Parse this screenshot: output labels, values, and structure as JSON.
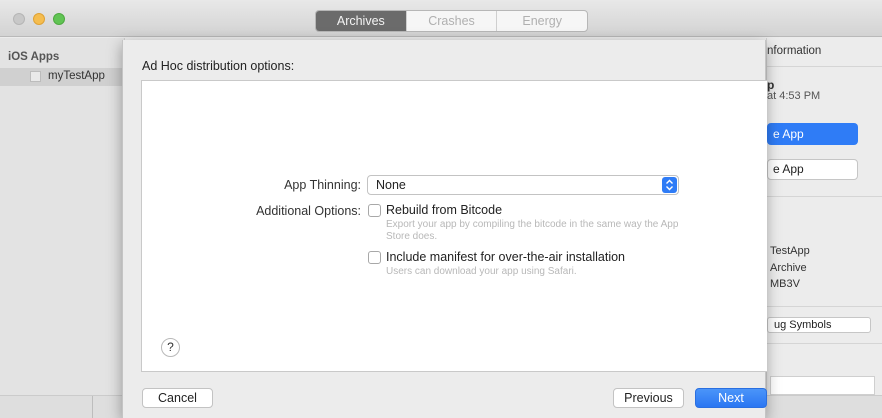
{
  "toolbar": {
    "tabs": [
      {
        "label": "Archives",
        "active": true
      },
      {
        "label": "Crashes",
        "active": false
      },
      {
        "label": "Energy",
        "active": false
      }
    ]
  },
  "sidebar": {
    "header": "iOS Apps",
    "items": [
      {
        "label": "myTestApp",
        "selected": true
      }
    ]
  },
  "right_panel": {
    "title": "nformation",
    "archive_name": "p",
    "archive_date": "at 4:53 PM",
    "primary_button": "e App",
    "secondary_button": "e App",
    "detail_lines": [
      "TestApp",
      "Archive",
      "MB3V"
    ],
    "symbols_button": "ug Symbols"
  },
  "sheet": {
    "title": "Ad Hoc distribution options:",
    "app_thinning_label": "App Thinning:",
    "app_thinning_value": "None",
    "additional_options_label": "Additional Options:",
    "options": [
      {
        "label": "Rebuild from Bitcode",
        "checked": false,
        "description": "Export your app by compiling the bitcode in the same way the App Store does."
      },
      {
        "label": "Include manifest for over-the-air installation",
        "checked": false,
        "description": "Users can download your app using Safari."
      }
    ],
    "help_label": "?",
    "cancel_label": "Cancel",
    "previous_label": "Previous",
    "next_label": "Next"
  },
  "colors": {
    "accent": "#2f7cf6",
    "segment_active": "#6b6b6b"
  },
  "icons": [
    "close-light-icon",
    "minimize-light-icon",
    "maximize-light-icon",
    "app-icon",
    "chevron-updown-icon",
    "help-icon"
  ]
}
